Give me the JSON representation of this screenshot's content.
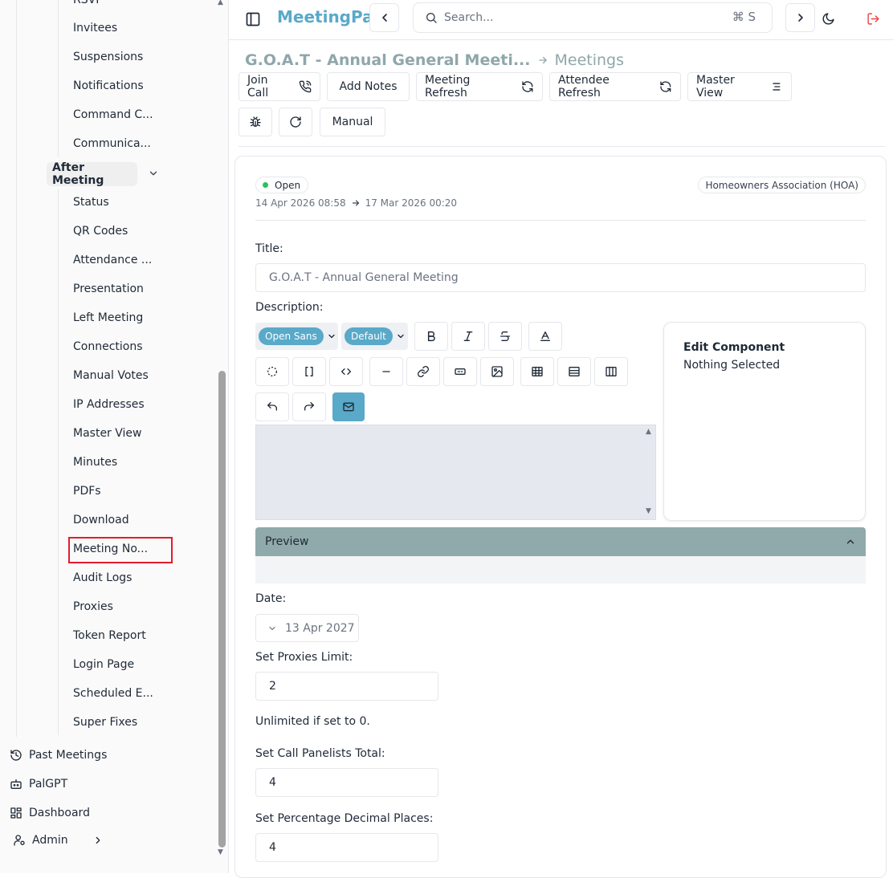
{
  "sidebar": {
    "top_items": [
      {
        "label": "RSVP"
      },
      {
        "label": "Invitees"
      },
      {
        "label": "Suspensions"
      },
      {
        "label": "Notifications"
      },
      {
        "label": "Command C..."
      },
      {
        "label": "Communica..."
      }
    ],
    "group_label": "After Meeting",
    "group_items": [
      {
        "label": "Status"
      },
      {
        "label": "QR Codes"
      },
      {
        "label": "Attendance ..."
      },
      {
        "label": "Presentation"
      },
      {
        "label": "Left Meeting"
      },
      {
        "label": "Connections"
      },
      {
        "label": "Manual Votes"
      },
      {
        "label": "IP Addresses"
      },
      {
        "label": "Master View"
      },
      {
        "label": "Minutes"
      },
      {
        "label": "PDFs"
      },
      {
        "label": "Download"
      },
      {
        "label": "Meeting No..."
      },
      {
        "label": "Audit Logs"
      },
      {
        "label": "Proxies"
      },
      {
        "label": "Token Report"
      },
      {
        "label": "Login Page"
      },
      {
        "label": "Scheduled E..."
      },
      {
        "label": "Super Fixes"
      }
    ],
    "main_nav": [
      {
        "label": "Past Meetings",
        "icon": "history-icon"
      },
      {
        "label": "PalGPT",
        "icon": "bot-icon"
      },
      {
        "label": "Dashboard",
        "icon": "dashboard-icon"
      },
      {
        "label": "Admin",
        "icon": "admin-icon"
      }
    ],
    "highlighted_item": "Meeting No..."
  },
  "topbar": {
    "brand": "MeetingPal",
    "search_placeholder": "Search...",
    "search_shortcut": "⌘ S"
  },
  "breadcrumb": {
    "meeting": "G.O.A.T - Annual General Meeti...",
    "section": "Meetings"
  },
  "toolbar": {
    "join_call": "Join Call",
    "add_notes": "Add Notes",
    "meeting_refresh": "Meeting Refresh",
    "attendee_refresh": "Attendee Refresh",
    "master_view": "Master View",
    "manual": "Manual"
  },
  "meeting": {
    "status": "Open",
    "start": "14 Apr 2026 08:58",
    "end": "17 Mar 2026 00:20",
    "org_type": "Homeowners Association (HOA)"
  },
  "form": {
    "title_label": "Title:",
    "title_value": "G.O.A.T - Annual General Meeting",
    "description_label": "Description:",
    "font_family": "Open Sans",
    "font_size": "Default",
    "edit_component_title": "Edit Component",
    "edit_component_status": "Nothing Selected",
    "preview_label": "Preview",
    "date_label": "Date:",
    "date_value": "13 Apr 2027",
    "proxies_label": "Set Proxies Limit:",
    "proxies_value": "2",
    "proxies_help": "Unlimited if set to 0.",
    "panelists_label": "Set Call Panelists Total:",
    "panelists_value": "4",
    "decimals_label": "Set Percentage Decimal Places:",
    "decimals_value": "4"
  },
  "colors": {
    "brand": "#59a9c9",
    "preview_bar": "#90a9ab",
    "status_open": "#22c55e",
    "logout": "#ef4444"
  }
}
